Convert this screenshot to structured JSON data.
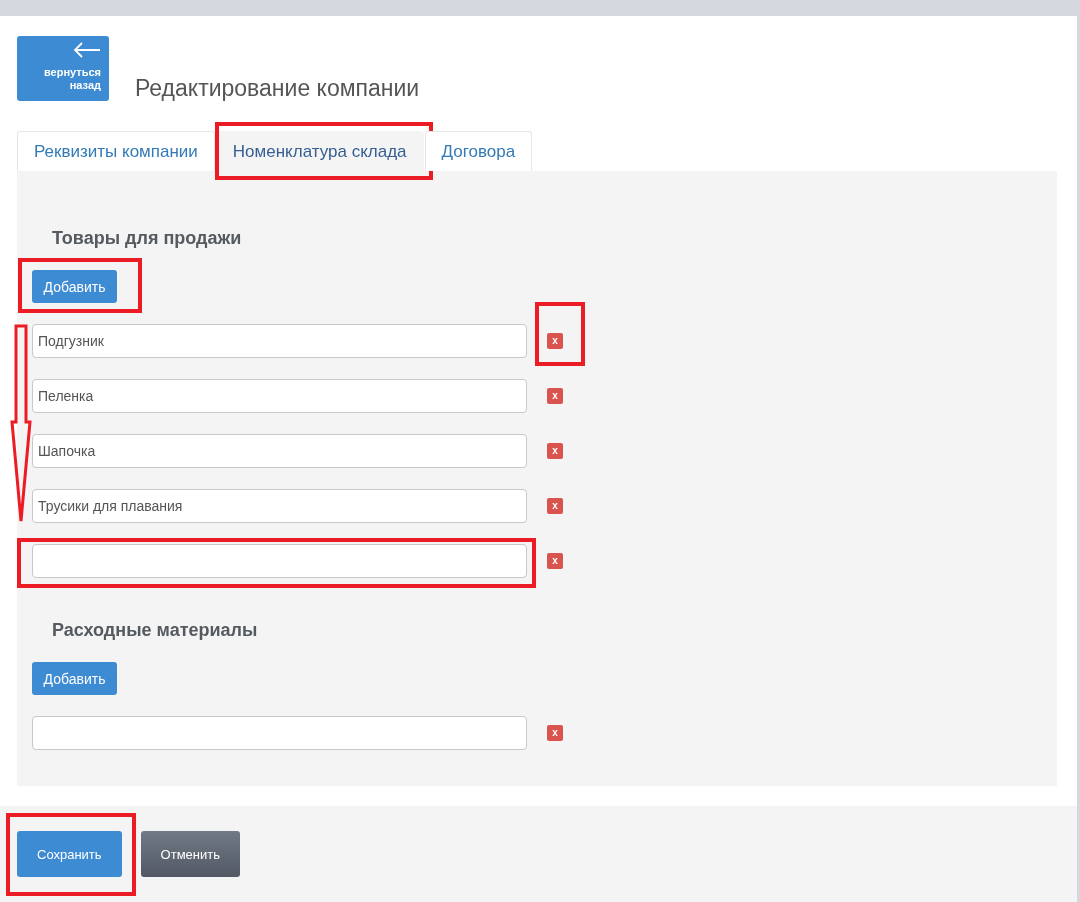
{
  "back_button": {
    "label": "вернуться назад"
  },
  "title": "Редактирование компании",
  "tabs": [
    {
      "label": "Реквизиты компании",
      "selected": false,
      "highlighted": false
    },
    {
      "label": "Номенклатура склада",
      "selected": true,
      "highlighted": true
    },
    {
      "label": "Договора",
      "selected": false,
      "highlighted": false
    }
  ],
  "sections": [
    {
      "heading": "Товары для продажи",
      "add_button": {
        "label": "Добавить",
        "highlighted": true
      },
      "arrow_annotation": true,
      "items": [
        {
          "value": "Подгузник",
          "delete_label": "x",
          "field_highlighted": false,
          "delete_highlighted": true
        },
        {
          "value": "Пеленка",
          "delete_label": "x",
          "field_highlighted": false,
          "delete_highlighted": false
        },
        {
          "value": "Шапочка",
          "delete_label": "x",
          "field_highlighted": false,
          "delete_highlighted": false
        },
        {
          "value": "Трусики для плавания",
          "delete_label": "x",
          "field_highlighted": false,
          "delete_highlighted": false
        },
        {
          "delete_label": "x",
          "field_highlighted": true,
          "delete_highlighted": false
        }
      ]
    },
    {
      "heading": "Расходные материалы",
      "add_button": {
        "label": "Добавить",
        "highlighted": false
      },
      "arrow_annotation": false,
      "items": [
        {
          "delete_label": "x",
          "field_highlighted": false,
          "delete_highlighted": false
        }
      ]
    }
  ],
  "footer": {
    "buttons": [
      {
        "label": "Сохранить",
        "kind": "primary",
        "highlighted": true
      },
      {
        "label": "Отменить",
        "kind": "secondary",
        "highlighted": false
      }
    ]
  }
}
